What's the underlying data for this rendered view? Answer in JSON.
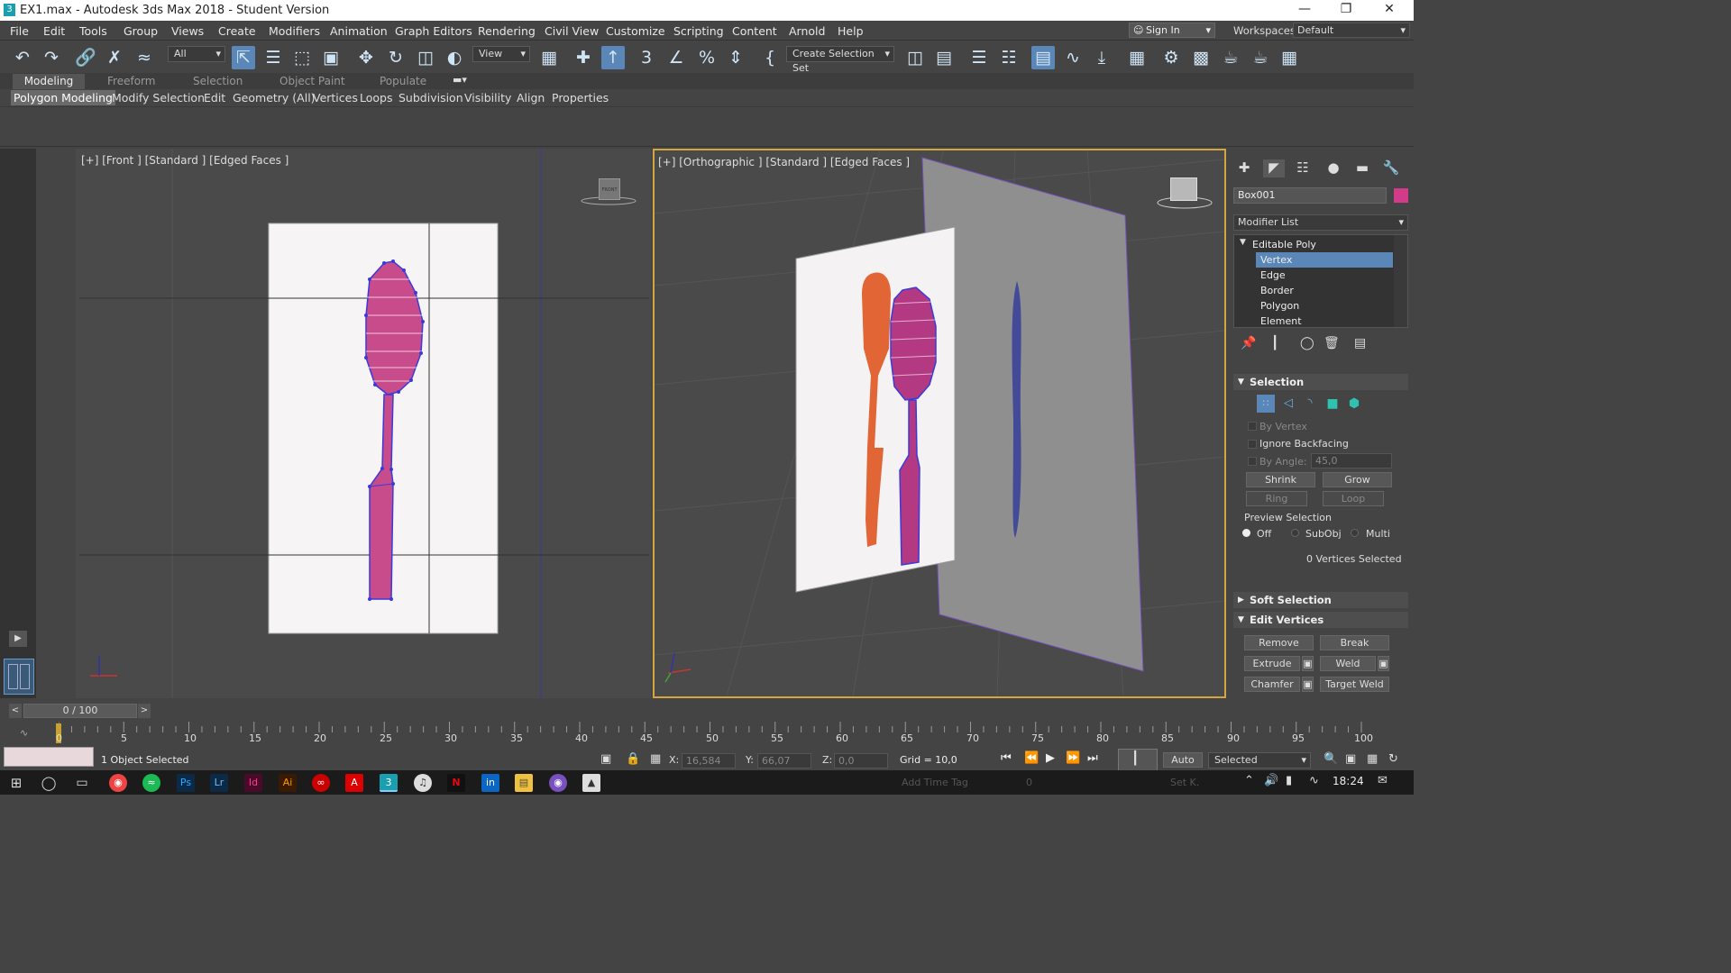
{
  "window": {
    "title": "EX1.max - Autodesk 3ds Max 2018 - Student Version"
  },
  "menu": {
    "items": [
      "File",
      "Edit",
      "Tools",
      "Group",
      "Views",
      "Create",
      "Modifiers",
      "Animation",
      "Graph Editors",
      "Rendering",
      "Civil View",
      "Customize",
      "Scripting",
      "Content",
      "Arnold",
      "Help"
    ]
  },
  "account": {
    "signin": "Sign In",
    "workspaces_label": "Workspaces:",
    "workspace": "Default"
  },
  "toolbar": {
    "filter": "All",
    "ref_coord": "View",
    "selection_set": "Create Selection Set"
  },
  "ribbon": {
    "tabs": [
      "Modeling",
      "Freeform",
      "Selection",
      "Object Paint",
      "Populate"
    ],
    "items": [
      "Polygon Modeling",
      "Modify Selection",
      "Edit",
      "Geometry (All)",
      "Vertices",
      "Loops",
      "Subdivision",
      "Visibility",
      "Align",
      "Properties"
    ]
  },
  "viewports": {
    "front": {
      "label": "[+] [Front ] [Standard ] [Edged Faces ]",
      "cube_label": "FRONT"
    },
    "ortho": {
      "label": "[+] [Orthographic ] [Standard ] [Edged Faces ]"
    }
  },
  "command_panel": {
    "object_name": "Box001",
    "object_color": "#d23b8a",
    "modifier_list": "Modifier List",
    "stack": [
      "Editable Poly",
      "Vertex",
      "Edge",
      "Border",
      "Polygon",
      "Element"
    ],
    "selection": {
      "header": "Selection",
      "by_vertex": "By Vertex",
      "ignore_backfacing": "Ignore Backfacing",
      "by_angle": "By Angle:",
      "angle_value": "45,0",
      "shrink": "Shrink",
      "grow": "Grow",
      "ring": "Ring",
      "loop": "Loop",
      "preview_label": "Preview Selection",
      "preview_options": [
        "Off",
        "SubObj",
        "Multi"
      ],
      "status": "0 Vertices Selected"
    },
    "soft_selection": "Soft Selection",
    "edit_vertices": {
      "header": "Edit Vertices",
      "buttons": [
        "Remove",
        "Break",
        "Extrude",
        "Weld",
        "Chamfer",
        "Target Weld"
      ]
    }
  },
  "timeline": {
    "slider": "0 / 100",
    "ticks": [
      "0",
      "5",
      "10",
      "15",
      "20",
      "25",
      "30",
      "35",
      "40",
      "45",
      "50",
      "55",
      "60",
      "65",
      "70",
      "75",
      "80",
      "85",
      "90",
      "95",
      "100"
    ]
  },
  "status": {
    "selected": "1 Object Selected",
    "x_label": "X:",
    "x": "16,584",
    "y_label": "Y:",
    "y": "66,07",
    "z_label": "Z:",
    "z": "0,0",
    "grid": "Grid = 10,0",
    "add_time_tag": "Add Time Tag",
    "auto": "Auto",
    "set_key": "Set K.",
    "key_filter": "Selected",
    "frame": "0"
  },
  "taskbar": {
    "time": "18:24"
  }
}
